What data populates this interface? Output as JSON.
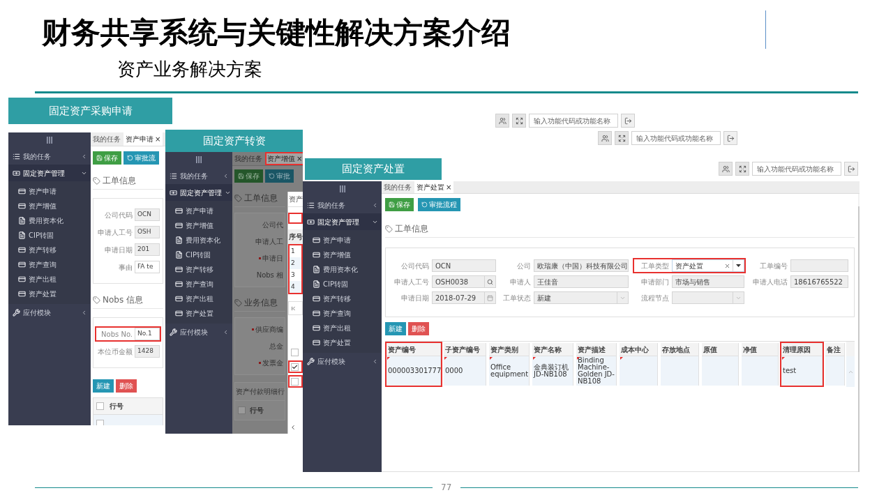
{
  "title": "财务共享系统与关键性解决方案介绍",
  "subtitle": "资产业务解决方案",
  "page_number": "77",
  "purchase_screen": {
    "caption": "固定资产采购申请",
    "toolbar": {
      "placeholder": "输入功能代码或功能名称"
    },
    "menu": [
      {
        "label": "我的任务",
        "kind": "list",
        "expanded": false
      },
      {
        "label": "固定资产管理",
        "kind": "money",
        "expanded": true,
        "children": [
          {
            "label": "资产申请",
            "kind": "card"
          },
          {
            "label": "资产增值",
            "kind": "card"
          },
          {
            "label": "费用资本化",
            "kind": "file"
          },
          {
            "label": "CIP转固",
            "kind": "file"
          },
          {
            "label": "资产转移",
            "kind": "card"
          },
          {
            "label": "资产查询",
            "kind": "card"
          },
          {
            "label": "资产出租",
            "kind": "card"
          },
          {
            "label": "资产处置",
            "kind": "card"
          }
        ]
      },
      {
        "label": "应付模块",
        "kind": "wrench",
        "expanded": false
      }
    ],
    "tabs": [
      {
        "label": "我的任务",
        "selected": false
      },
      {
        "label": "资产申请",
        "close": "×",
        "selected": true
      }
    ],
    "buttons": [
      {
        "label": "保存",
        "kind": "save"
      },
      {
        "label": "审批流",
        "kind": "flow"
      }
    ],
    "sections": [
      {
        "heading": "工单信息",
        "fields": [
          {
            "label": "公司代码",
            "value": "OCN",
            "editable": false,
            "highlighted": false
          },
          {
            "label": "申请人工号",
            "value": "OSH",
            "editable": false,
            "highlighted": false
          },
          {
            "label": "申请日期",
            "value": "201",
            "editable": false,
            "highlighted": false
          },
          {
            "label": "事由",
            "value": "FA te",
            "editable": true,
            "highlighted": false
          }
        ]
      },
      {
        "heading": "Nobs 信息",
        "fields": [
          {
            "label": "Nobs No.",
            "value": "No.1",
            "editable": true,
            "highlighted": true
          },
          {
            "label": "本位币金额",
            "value": "1428",
            "editable": false,
            "highlighted": false
          }
        ]
      }
    ],
    "actions": [
      {
        "label": "新建",
        "kind": "new"
      },
      {
        "label": "删除",
        "kind": "delete"
      }
    ],
    "table": {
      "select_all": {
        "checked": false
      },
      "columns": [
        "行号"
      ],
      "rows": [
        {
          "checked": false
        }
      ]
    }
  },
  "transfer_screen": {
    "caption": "固定资产转资",
    "toolbar": {
      "placeholder": "输入功能代码或功能名称"
    },
    "menu": [
      {
        "label": "我的任务",
        "kind": "list",
        "expanded": false
      },
      {
        "label": "固定资产管理",
        "kind": "money",
        "expanded": true,
        "children": [
          {
            "label": "资产申请",
            "kind": "card"
          },
          {
            "label": "资产增值",
            "kind": "card"
          },
          {
            "label": "费用资本化",
            "kind": "file"
          },
          {
            "label": "CIP转固",
            "kind": "file"
          },
          {
            "label": "资产转移",
            "kind": "card"
          },
          {
            "label": "资产查询",
            "kind": "card"
          },
          {
            "label": "资产出租",
            "kind": "card"
          },
          {
            "label": "资产处置",
            "kind": "card"
          }
        ]
      },
      {
        "label": "应付模块",
        "kind": "wrench",
        "expanded": false
      }
    ],
    "tabs": [
      {
        "label": "我的任务",
        "selected": false,
        "highlighted": false
      },
      {
        "label": "资产增值",
        "close": "×",
        "selected": true,
        "highlighted": true
      }
    ],
    "buttons": [
      {
        "label": "保存",
        "kind": "save"
      },
      {
        "label": "审批",
        "kind": "flow"
      }
    ],
    "sections": [
      {
        "heading": "工单信息",
        "fields": [
          {
            "label": "公司代",
            "required": false
          },
          {
            "label": "申请人工",
            "required": false
          },
          {
            "label": "申请日",
            "required": true
          },
          {
            "label": "Nobs 相",
            "required": false
          }
        ]
      },
      {
        "heading": "业务信息",
        "fields": [
          {
            "label": "供应商编",
            "required": true
          },
          {
            "label": "总金",
            "required": false
          },
          {
            "label": "发票金",
            "required": true
          }
        ]
      }
    ],
    "detail": {
      "tab": "资产付款明细行",
      "select_all": {
        "checked": false
      },
      "columns": [
        "行号"
      ]
    },
    "dialog": {
      "title": "资产",
      "filter_highlighted": true,
      "header": "序号",
      "rows": [
        "1",
        "2",
        "3",
        "4"
      ],
      "rows_highlighted": true,
      "checks": [
        {
          "checked": false,
          "highlighted": false
        },
        {
          "checked": true,
          "highlighted": true
        },
        {
          "checked": false,
          "highlighted": true
        }
      ]
    }
  },
  "disposal_screen": {
    "caption": "固定资产处置",
    "toolbar": {
      "placeholder": "输入功能代码或功能名称"
    },
    "menu": [
      {
        "label": "我的任务",
        "kind": "list",
        "expanded": false
      },
      {
        "label": "固定资产管理",
        "kind": "money",
        "expanded": true,
        "children": [
          {
            "label": "资产申请",
            "kind": "card"
          },
          {
            "label": "资产增值",
            "kind": "card"
          },
          {
            "label": "费用资本化",
            "kind": "file"
          },
          {
            "label": "CIP转固",
            "kind": "file"
          },
          {
            "label": "资产转移",
            "kind": "card"
          },
          {
            "label": "资产查询",
            "kind": "card"
          },
          {
            "label": "资产出租",
            "kind": "card"
          },
          {
            "label": "资产处置",
            "kind": "card"
          }
        ]
      },
      {
        "label": "应付模块",
        "kind": "wrench",
        "expanded": false
      }
    ],
    "tabs": [
      {
        "label": "我的任务",
        "selected": false
      },
      {
        "label": "资产处置",
        "close": "×",
        "selected": true
      }
    ],
    "buttons": [
      {
        "label": "保存",
        "kind": "save"
      },
      {
        "label": "审批流程",
        "kind": "flow"
      }
    ],
    "section": {
      "heading": "工单信息",
      "fields": [
        {
          "label": "公司代码",
          "value": "OCN",
          "kind": "text",
          "highlighted": false
        },
        {
          "label": "公司",
          "value": "欧瑞康（中国）科技有限公司",
          "kind": "text",
          "highlighted": false
        },
        {
          "label": "工单类型",
          "value": "资产处置",
          "kind": "choice",
          "highlighted": true
        },
        {
          "label": "工单编号",
          "kind": "text",
          "highlighted": false
        },
        {
          "label": "申请人工号",
          "value": "OSH0038",
          "kind": "lookup",
          "highlighted": false
        },
        {
          "label": "申请人",
          "value": "王佳音",
          "kind": "text",
          "highlighted": false
        },
        {
          "label": "申请部门",
          "value": "市场与销售",
          "kind": "text",
          "highlighted": false
        },
        {
          "label": "申请人电话",
          "value": "18616765522",
          "kind": "text",
          "highlighted": false
        },
        {
          "label": "申请日期",
          "value": "2018-07-29",
          "kind": "date",
          "highlighted": false
        },
        {
          "label": "工单状态",
          "value": "新建",
          "kind": "select",
          "highlighted": false
        },
        {
          "label": "流程节点",
          "kind": "select",
          "highlighted": false
        }
      ]
    },
    "actions": [
      {
        "label": "新建",
        "kind": "new"
      },
      {
        "label": "删除",
        "kind": "delete"
      }
    ],
    "table": {
      "columns": [
        {
          "label": "资产编号",
          "highlighted": true
        },
        {
          "label": "子资产编号",
          "highlighted": false
        },
        {
          "label": "资产类别",
          "highlighted": false
        },
        {
          "label": "资产名称",
          "highlighted": false
        },
        {
          "label": "资产描述",
          "highlighted": false
        },
        {
          "label": "成本中心",
          "highlighted": false
        },
        {
          "label": "存放地点",
          "highlighted": false
        },
        {
          "label": "原值",
          "highlighted": false
        },
        {
          "label": "净值",
          "highlighted": false
        },
        {
          "label": "清理原因",
          "highlighted": true
        },
        {
          "label": "备注",
          "highlighted": false
        }
      ],
      "rows": [
        {
          "cells": [
            {
              "text": "000003301777",
              "flagged": true
            },
            {
              "text": "0000",
              "flagged": true
            },
            {
              "text": "Office equipment",
              "flagged": true
            },
            {
              "text": "金典装订机JD-NB108",
              "flagged": true
            },
            {
              "text": "Binding Machine-Golden JD-NB108",
              "flagged": true
            },
            {
              "flagged": true
            },
            {
              "flagged": false
            },
            {
              "flagged": false
            },
            {
              "flagged": false
            },
            {
              "text": "test",
              "flagged": true
            },
            {
              "flagged": false
            }
          ]
        }
      ]
    }
  }
}
